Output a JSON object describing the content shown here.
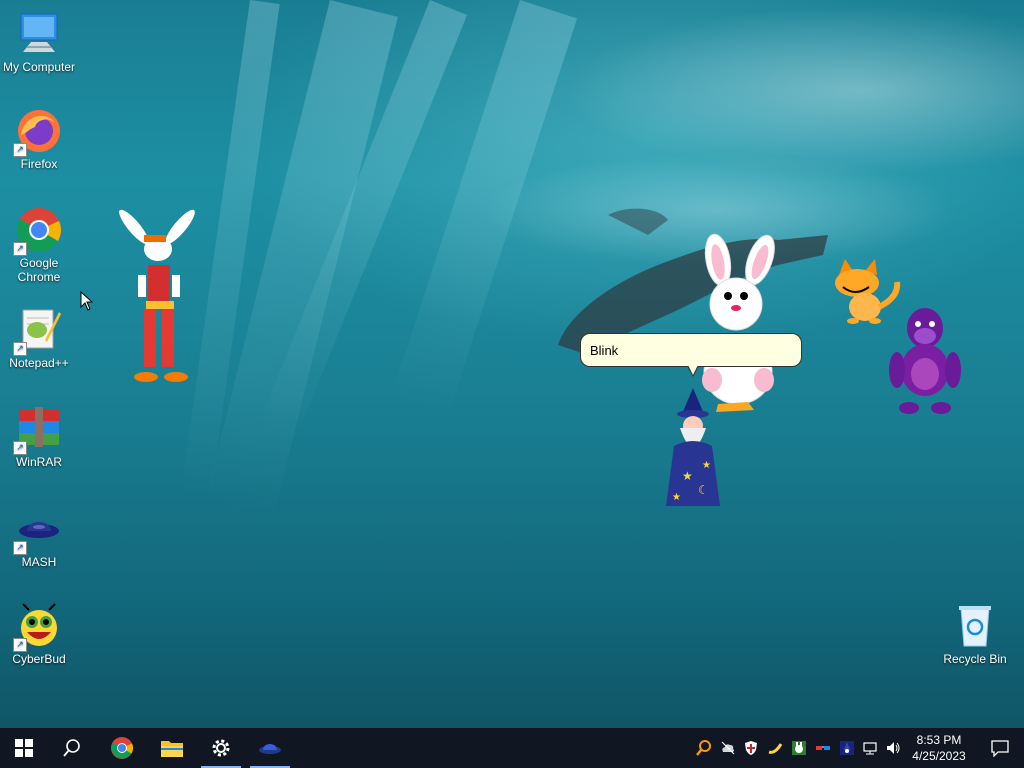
{
  "desktop_icons": [
    {
      "label": "My Computer",
      "icon": "computer-icon"
    },
    {
      "label": "Firefox",
      "icon": "firefox-icon"
    },
    {
      "label": "Google Chrome",
      "icon": "chrome-icon"
    },
    {
      "label": "Notepad++",
      "icon": "notepadpp-icon"
    },
    {
      "label": "WinRAR",
      "icon": "winrar-icon"
    },
    {
      "label": "MASH",
      "icon": "mash-icon"
    },
    {
      "label": "CyberBud",
      "icon": "cyberbud-icon"
    },
    {
      "label": "Recycle Bin",
      "icon": "recycle-bin-icon"
    }
  ],
  "agents": {
    "balloon_text": "Blink"
  },
  "taskbar": {
    "apps": [
      {
        "name": "start",
        "icon": "windows-start-icon"
      },
      {
        "name": "search",
        "icon": "search-icon"
      },
      {
        "name": "chrome",
        "icon": "chrome-icon"
      },
      {
        "name": "file-explorer",
        "icon": "folder-icon"
      },
      {
        "name": "settings",
        "icon": "gear-icon",
        "active": true
      },
      {
        "name": "mash",
        "icon": "mash-icon",
        "active": true
      }
    ],
    "clock": {
      "time": "8:53 PM",
      "date": "4/25/2023"
    }
  },
  "colors": {
    "taskbar": "#101722",
    "balloon": "#ffffe1",
    "desktop": "#1a7e93"
  }
}
